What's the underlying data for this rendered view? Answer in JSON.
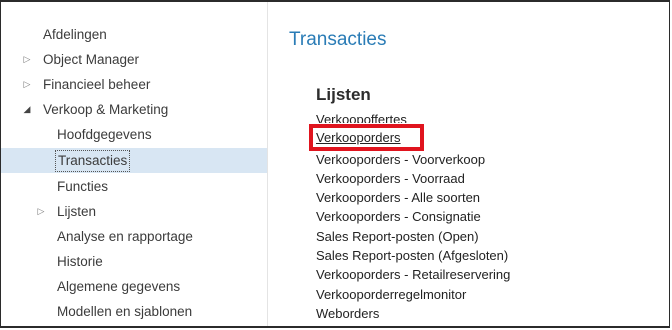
{
  "sidebar": {
    "items": [
      {
        "label": "Afdelingen",
        "expander": ""
      },
      {
        "label": "Object Manager",
        "expander": "collapsed"
      },
      {
        "label": "Financieel beheer",
        "expander": "collapsed"
      },
      {
        "label": "Verkoop & Marketing",
        "expander": "expanded"
      },
      {
        "label": "Hoofdgegevens",
        "expander": ""
      },
      {
        "label": "Transacties",
        "expander": "",
        "selected": true
      },
      {
        "label": "Functies",
        "expander": ""
      },
      {
        "label": "Lijsten",
        "expander": "collapsed"
      },
      {
        "label": "Analyse en rapportage",
        "expander": ""
      },
      {
        "label": "Historie",
        "expander": ""
      },
      {
        "label": "Algemene gegevens",
        "expander": ""
      },
      {
        "label": "Modellen en sjablonen",
        "expander": ""
      }
    ]
  },
  "main": {
    "title": "Transacties",
    "section_heading": "Lijsten",
    "links": [
      "Verkoopoffertes",
      "Verkooporders",
      "Verkooporders - Voorverkoop",
      "Verkooporders - Voorraad",
      "Verkooporders - Alle soorten",
      "Verkooporders - Consignatie",
      "Sales Report-posten (Open)",
      "Sales Report-posten (Afgesloten)",
      "Verkooporders - Retailreservering",
      "Verkooporderregelmonitor",
      "Weborders"
    ]
  },
  "colors": {
    "title": "#2a7cb6",
    "selection": "#d8e6f3",
    "highlight_box": "#e0141e"
  }
}
